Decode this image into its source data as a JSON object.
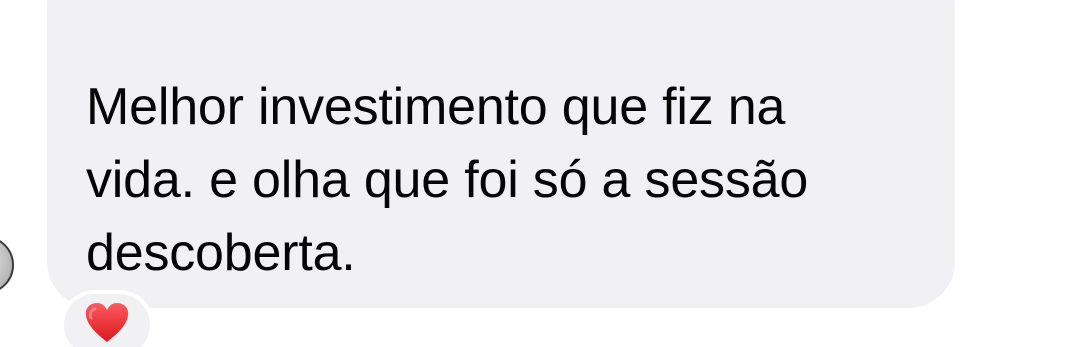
{
  "message": {
    "text": "Melhor investimento que fiz na\nvida. e olha que foi só a sessão\ndescoberta."
  },
  "reaction": {
    "icon": "red-heart-icon",
    "color": "#e5282e"
  },
  "colors": {
    "bubble": "#f1f1f3",
    "text": "#050505",
    "background": "#ffffff"
  }
}
